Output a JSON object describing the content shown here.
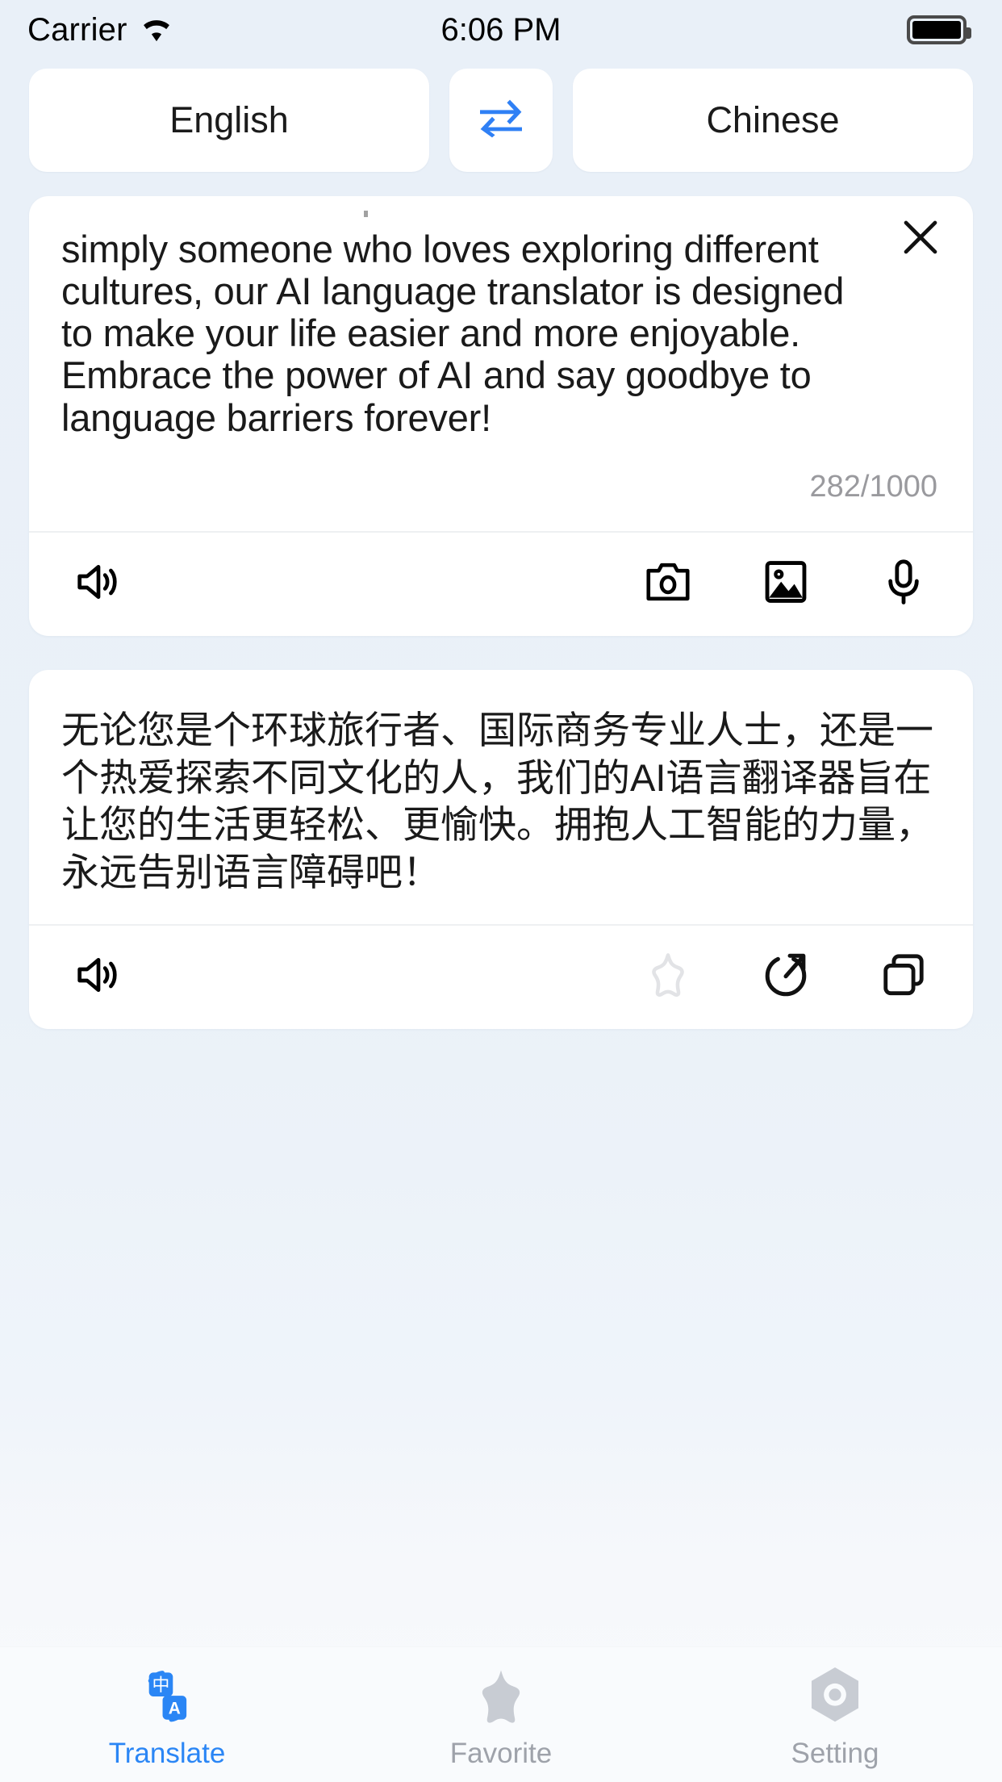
{
  "status_bar": {
    "carrier": "Carrier",
    "wifi_icon": "wifi-icon",
    "time": "6:06 PM",
    "battery_icon": "battery-full-icon"
  },
  "language_selector": {
    "source_language": "English",
    "target_language": "Chinese",
    "swap_icon": "swap-horizontal-arrows-icon",
    "swap_accent_color": "#2f80f5"
  },
  "source_card": {
    "text": "simply someone who loves exploring different cultures, our AI language translator is designed to make your life easier and more enjoyable. Embrace the power of AI and say goodbye to language barriers forever!",
    "close_icon": "close-icon",
    "counter": "282/1000",
    "char_count": 282,
    "char_limit": 1000,
    "toolbar": {
      "speak_icon": "speaker-icon",
      "camera_icon": "camera-icon",
      "image_icon": "image-icon",
      "mic_icon": "microphone-icon"
    }
  },
  "target_card": {
    "text": "无论您是个环球旅行者、国际商务专业人士，还是一个热爱探索不同文化的人，我们的AI语言翻译器旨在让您的生活更轻松、更愉快。拥抱人工智能的力量，永远告别语言障碍吧！",
    "toolbar": {
      "speak_icon": "speaker-icon",
      "favorite_icon": "star-outline-icon",
      "share_icon": "share-icon",
      "copy_icon": "copy-icon"
    }
  },
  "tab_bar": {
    "active_color": "#2b86f5",
    "inactive_color": "#9ea2aa",
    "tabs": [
      {
        "label": "Translate",
        "icon": "translate-icon",
        "active": true
      },
      {
        "label": "Favorite",
        "icon": "star-icon",
        "active": false
      },
      {
        "label": "Setting",
        "icon": "gear-nut-icon",
        "active": false
      }
    ]
  }
}
